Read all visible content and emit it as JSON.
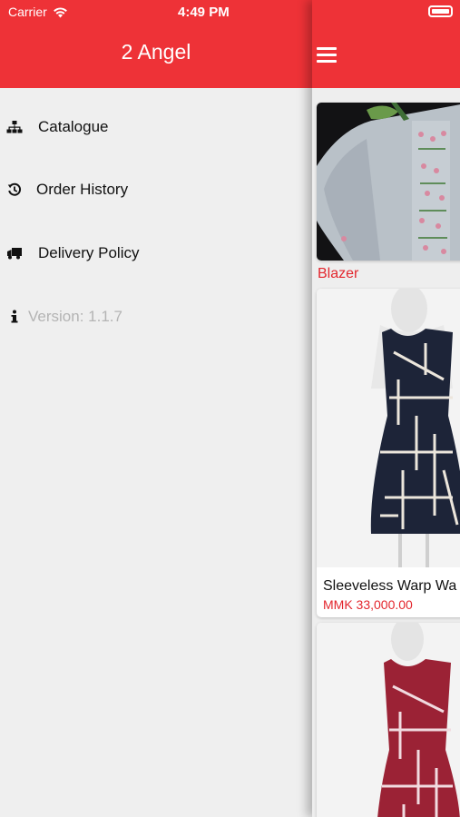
{
  "status_bar": {
    "carrier": "Carrier",
    "time": "4:49 PM"
  },
  "drawer": {
    "title": "2 Angel",
    "items": [
      {
        "label": "Catalogue",
        "icon": "sitemap-icon"
      },
      {
        "label": "Order History",
        "icon": "history-icon"
      },
      {
        "label": "Delivery Policy",
        "icon": "truck-icon"
      }
    ],
    "version": "Version: 1.1.7"
  },
  "main": {
    "category_label": "Blazer",
    "products": [
      {
        "name": "Sleeveless Warp Wa",
        "price": "MMK 33,000.00"
      }
    ]
  },
  "colors": {
    "accent": "#ee3237",
    "price": "#e3262d"
  }
}
